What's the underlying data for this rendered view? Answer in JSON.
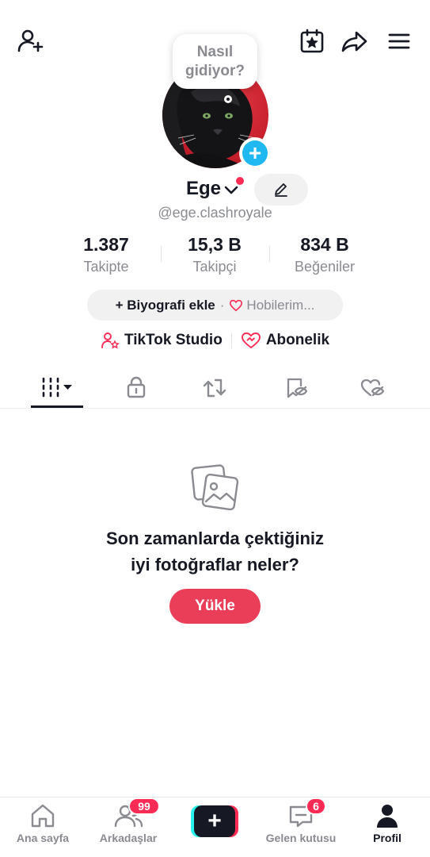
{
  "header": {
    "add_friend_icon": "add-user-icon",
    "calendar_icon": "calendar-star-icon",
    "share_icon": "share-arrow-icon",
    "menu_icon": "hamburger-menu-icon"
  },
  "profile": {
    "bubble_text": "Nasıl\ngidiyor?",
    "name": "Ege",
    "handle": "@ege.clashroyale",
    "add_badge": "+"
  },
  "stats": [
    {
      "value": "1.387",
      "label": "Takipte"
    },
    {
      "value": "15,3 B",
      "label": "Takipçi"
    },
    {
      "value": "834 B",
      "label": "Beğeniler"
    }
  ],
  "bio": {
    "add_label": "+ Biyografi ekle",
    "separator": "·",
    "hobbies_label": "Hobilerim..."
  },
  "links": {
    "studio": "TikTok Studio",
    "subscription": "Abonelik"
  },
  "tabs": [
    "videos",
    "private",
    "reposts",
    "favorites",
    "liked"
  ],
  "empty_state": {
    "title": "Son zamanlarda çektiğiniz\niyi fotoğraflar neler?",
    "button": "Yükle"
  },
  "bottom_nav": {
    "home": "Ana sayfa",
    "friends": "Arkadaşlar",
    "friends_badge": "99",
    "create": "+",
    "inbox": "Gelen kutusu",
    "inbox_badge": "6",
    "profile": "Profil"
  },
  "colors": {
    "accent": "#fe2c55",
    "upload_button": "#ea3d58",
    "badge_blue": "#20b8f0",
    "text_primary": "#161823",
    "text_secondary": "#8a8b91"
  }
}
